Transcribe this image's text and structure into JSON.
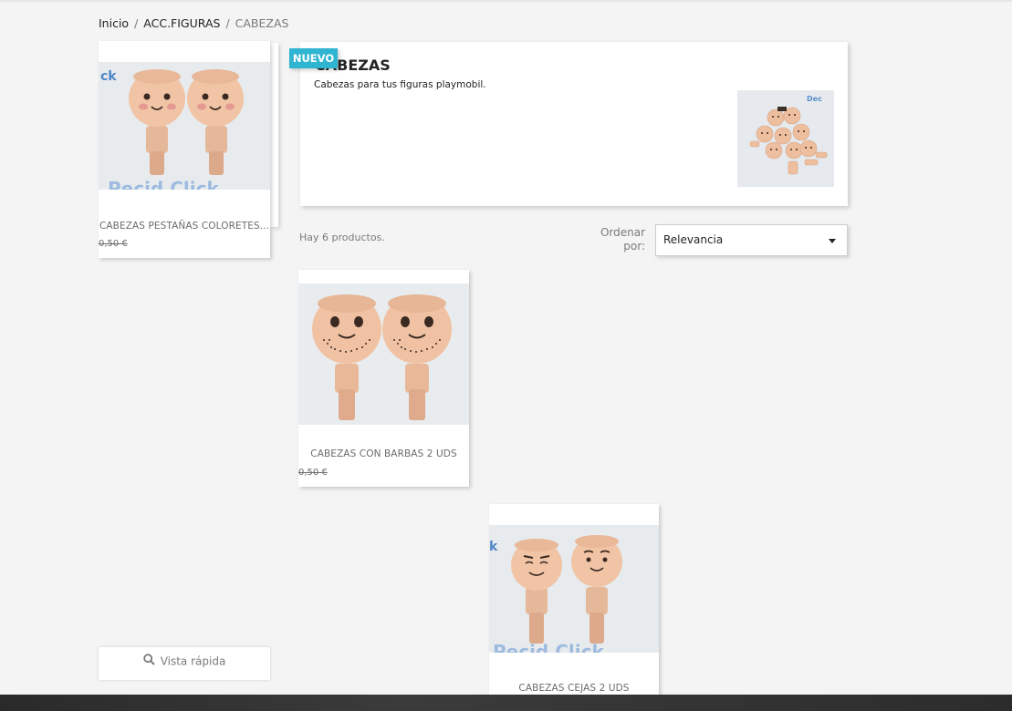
{
  "breadcrumb": {
    "items": [
      {
        "label": "Inicio"
      },
      {
        "label": "ACC.FIGURAS"
      },
      {
        "label": "CABEZAS"
      }
    ],
    "separator": "/"
  },
  "category": {
    "badge": "NUEVO",
    "title": "CABEZAS",
    "description": "Cabezas para tus figuras playmobil."
  },
  "listing": {
    "count_text": "Hay 6 productos.",
    "sort_label": "Ordenar por:",
    "sort_value": "Relevancia"
  },
  "products": [
    {
      "title": "CABEZAS PESTAÑAS COLORETES...",
      "price": "0,50 €"
    },
    {
      "title": "CABEZAS CON BARBAS 2 UDS",
      "price": "0,50 €"
    },
    {
      "title": "CABEZAS CEJAS 2 UDS"
    }
  ],
  "quick_view": {
    "label": "Vista rápida",
    "icon": "search-icon"
  },
  "colors": {
    "accent": "#2fb5d2",
    "background": "#f4f4f4",
    "text": "#232323"
  }
}
